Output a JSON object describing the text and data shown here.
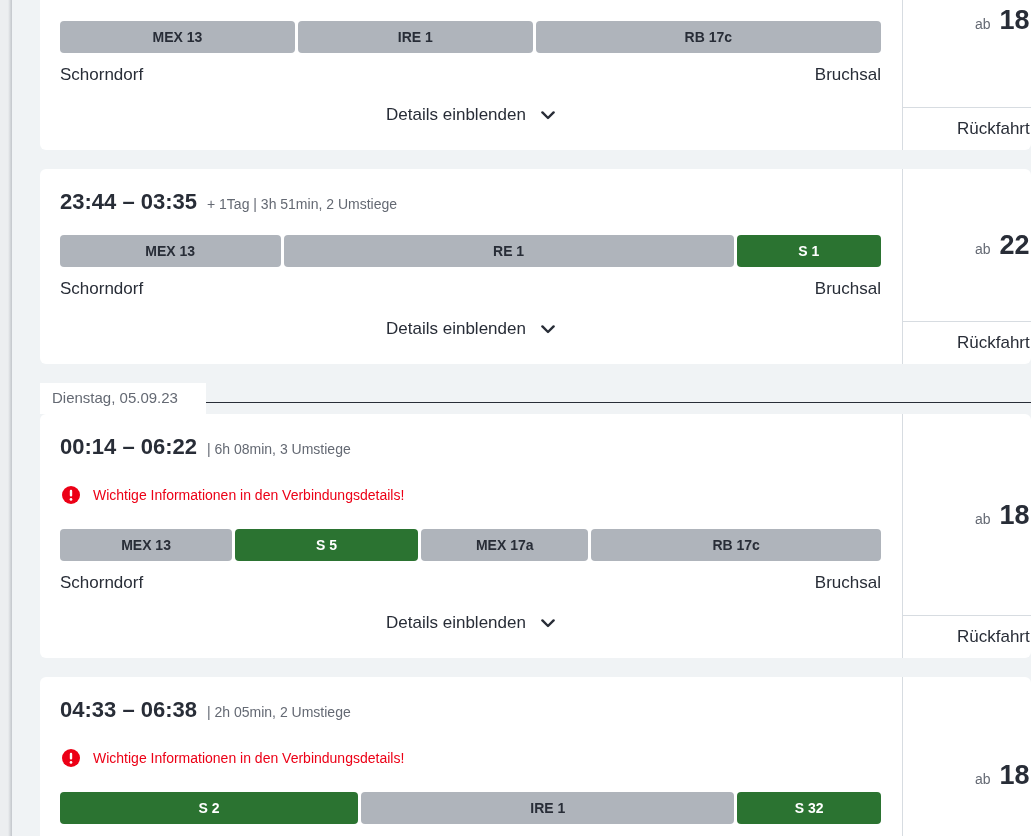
{
  "days": [
    {
      "connections": [
        {
          "segments": [
            {
              "label": "MEX 13",
              "color": "#afb4bb"
            },
            {
              "label": "IRE 1",
              "color": "#afb4bb"
            },
            {
              "label": "RB 17c",
              "color": "#afb4bb"
            }
          ],
          "from": "Schorndorf",
          "to": "Bruchsal",
          "details": "Details einblenden",
          "price_prefix": "ab",
          "price": "18",
          "return_trip": "Rückfahrt"
        },
        {
          "times": "23:44 – 03:35",
          "info": "+ 1Tag | 3h 51min, 2 Umstiege",
          "segments": [
            {
              "label": "MEX 13",
              "color": "#afb4bb"
            },
            {
              "label": "RE 1",
              "color": "#afb4bb"
            },
            {
              "label": "S 1",
              "color": "#2b7331"
            }
          ],
          "from": "Schorndorf",
          "to": "Bruchsal",
          "details": "Details einblenden",
          "price_prefix": "ab",
          "price": "22",
          "return_trip": "Rückfahrt"
        }
      ]
    },
    {
      "date": "Dienstag, 05.09.23",
      "connections": [
        {
          "times": "00:14 – 06:22",
          "info": "| 6h 08min, 3 Umstiege",
          "warning": "Wichtige Informationen in den Verbindungsdetails!",
          "segments": [
            {
              "label": "MEX 13",
              "color": "#afb4bb"
            },
            {
              "label": "S 5",
              "color": "#2b7331"
            },
            {
              "label": "MEX 17a",
              "color": "#afb4bb"
            },
            {
              "label": "RB 17c",
              "color": "#afb4bb"
            }
          ],
          "from": "Schorndorf",
          "to": "Bruchsal",
          "details": "Details einblenden",
          "price_prefix": "ab",
          "price": "18",
          "return_trip": "Rückfahrt"
        },
        {
          "times": "04:33 – 06:38",
          "info": "| 2h 05min, 2 Umstiege",
          "warning": "Wichtige Informationen in den Verbindungsdetails!",
          "segments": [
            {
              "label": "S 2",
              "color": "#2b7331"
            },
            {
              "label": "IRE 1",
              "color": "#afb4bb"
            },
            {
              "label": "S 32",
              "color": "#2b7331"
            }
          ],
          "price_prefix": "ab",
          "price": "18"
        }
      ]
    }
  ]
}
